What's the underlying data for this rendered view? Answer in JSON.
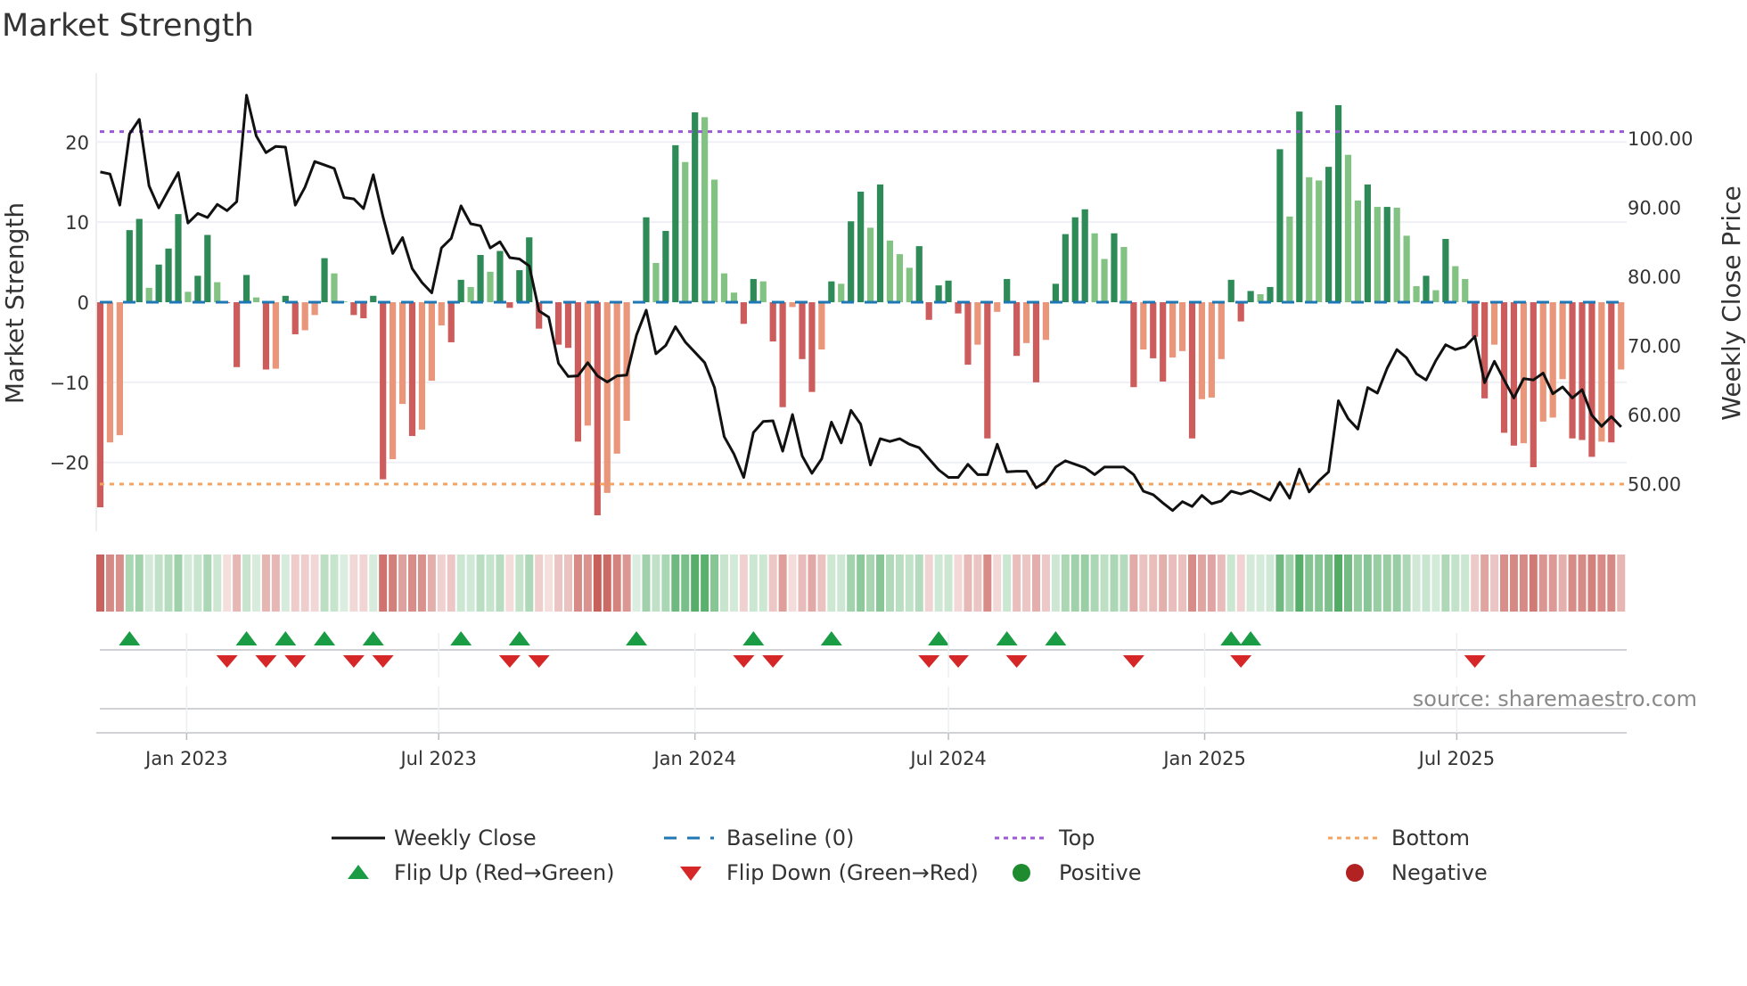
{
  "chart_data": {
    "type": "bar+line",
    "title": "Market Strength",
    "ylabel_left": "Market Strength",
    "ylabel_right": "Weekly Close Price",
    "start_date": "2022-10-31",
    "frequency": "weekly",
    "ylim_left": [
      -28.6,
      28.6
    ],
    "ylim_right": [
      43.1,
      109.4
    ],
    "left_ticks": [
      {
        "v": 20,
        "label": "20"
      },
      {
        "v": 10,
        "label": "10"
      },
      {
        "v": 0,
        "label": "0"
      },
      {
        "v": -10,
        "label": "−10"
      },
      {
        "v": -20,
        "label": "−20"
      }
    ],
    "right_ticks": [
      {
        "v": 100,
        "label": "100.00"
      },
      {
        "v": 90,
        "label": "90.00"
      },
      {
        "v": 80,
        "label": "80.00"
      },
      {
        "v": 70,
        "label": "70.00"
      },
      {
        "v": 60,
        "label": "60.00"
      },
      {
        "v": 50,
        "label": "50.00"
      }
    ],
    "x_ticks": [
      {
        "date": "2023-01-01",
        "label": "Jan 2023"
      },
      {
        "date": "2023-07-01",
        "label": "Jul 2023"
      },
      {
        "date": "2024-01-01",
        "label": "Jan 2024"
      },
      {
        "date": "2024-07-01",
        "label": "Jul 2024"
      },
      {
        "date": "2025-01-01",
        "label": "Jan 2025"
      },
      {
        "date": "2025-07-01",
        "label": "Jul 2025"
      }
    ],
    "top_level": 21.3,
    "bottom_level": -22.7,
    "baseline": 0,
    "strength": [
      -25.6,
      -17.5,
      -16.6,
      9.0,
      10.4,
      1.8,
      4.7,
      6.7,
      11.0,
      1.3,
      3.3,
      8.4,
      2.5,
      -0.1,
      -8.1,
      3.4,
      0.6,
      -8.4,
      -8.3,
      0.8,
      -4.0,
      -3.5,
      -1.6,
      5.5,
      3.6,
      0.1,
      -1.6,
      -2.0,
      0.8,
      -22.1,
      -19.6,
      -12.7,
      -16.7,
      -15.9,
      -9.8,
      -2.9,
      -5.0,
      2.8,
      1.9,
      5.9,
      3.8,
      6.4,
      -0.7,
      4.0,
      8.1,
      -3.3,
      -0.1,
      -5.3,
      -5.7,
      -17.4,
      -15.4,
      -26.6,
      -23.8,
      -18.9,
      -14.8,
      0.1,
      10.6,
      4.9,
      8.9,
      19.6,
      17.5,
      23.7,
      23.1,
      15.3,
      3.6,
      1.2,
      -2.7,
      2.9,
      2.6,
      -4.9,
      -13.1,
      -0.6,
      -7.1,
      -11.2,
      -5.9,
      2.6,
      2.3,
      10.1,
      13.8,
      9.3,
      14.7,
      7.7,
      6.0,
      4.3,
      7.0,
      -2.2,
      2.1,
      2.7,
      -1.4,
      -7.8,
      -5.3,
      -17.0,
      -1.2,
      2.9,
      -6.7,
      -5.1,
      -10.0,
      -4.7,
      2.3,
      8.5,
      10.6,
      11.6,
      8.6,
      5.4,
      8.6,
      6.9,
      -10.6,
      -5.9,
      -7.0,
      -9.9,
      -6.9,
      -6.1,
      -17.0,
      -12.1,
      -11.9,
      -7.1,
      2.8,
      -2.4,
      1.4,
      1.0,
      1.9,
      19.1,
      10.7,
      23.8,
      15.6,
      15.2,
      16.9,
      24.6,
      18.4,
      12.7,
      14.7,
      11.9,
      11.9,
      11.8,
      8.3,
      2.0,
      3.3,
      1.5,
      7.9,
      4.5,
      2.9,
      -4.3,
      -12.0,
      -5.3,
      -16.3,
      -17.9,
      -17.6,
      -20.6,
      -14.9,
      -14.4,
      -9.6,
      -17.0,
      -17.2,
      -19.3,
      -17.4,
      -17.5,
      -8.4
    ],
    "weekly_close": [
      95.1,
      94.8,
      90.3,
      100.6,
      102.7,
      93.1,
      89.9,
      92.5,
      95.0,
      87.7,
      89.1,
      88.5,
      90.4,
      89.5,
      90.8,
      106.2,
      100.3,
      97.9,
      98.8,
      98.7,
      90.3,
      92.9,
      96.6,
      96.1,
      95.6,
      91.4,
      91.2,
      89.8,
      94.7,
      88.6,
      83.3,
      85.6,
      81.1,
      79.1,
      77.6,
      84.1,
      85.5,
      90.2,
      87.6,
      87.3,
      84.1,
      85.0,
      82.7,
      82.5,
      81.5,
      75.0,
      74.1,
      67.4,
      65.5,
      65.6,
      67.5,
      65.6,
      64.7,
      65.6,
      65.7,
      71.5,
      75.1,
      68.8,
      70.0,
      72.7,
      70.5,
      69.0,
      67.5,
      63.9,
      56.8,
      54.3,
      50.9,
      57.4,
      59.0,
      59.1,
      54.7,
      60.0,
      54.0,
      51.5,
      53.6,
      58.9,
      55.9,
      60.6,
      58.6,
      52.7,
      56.5,
      56.1,
      56.5,
      55.7,
      55.2,
      53.6,
      52.0,
      50.9,
      50.9,
      52.8,
      51.3,
      51.3,
      55.7,
      51.7,
      51.8,
      51.8,
      49.4,
      50.3,
      52.4,
      53.3,
      52.8,
      52.3,
      51.3,
      52.4,
      52.4,
      52.4,
      51.3,
      48.9,
      48.4,
      47.2,
      46.1,
      47.4,
      46.7,
      48.3,
      47.1,
      47.5,
      48.9,
      48.5,
      49.0,
      48.3,
      47.6,
      50.2,
      47.9,
      52.1,
      48.8,
      50.4,
      51.7,
      62.0,
      59.4,
      57.9,
      63.9,
      63.1,
      66.7,
      69.4,
      68.2,
      65.9,
      65.0,
      67.8,
      70.1,
      69.4,
      69.8,
      71.3,
      64.6,
      67.7,
      65.0,
      62.4,
      65.2,
      65.0,
      66.0,
      63.0,
      64.0,
      62.4,
      63.6,
      59.9,
      58.3,
      59.7,
      58.2
    ],
    "legend_position": "bottom-center",
    "legend": [
      {
        "key": "close",
        "label": "Weekly Close"
      },
      {
        "key": "baseline",
        "label": "Baseline (0)"
      },
      {
        "key": "top",
        "label": "Top"
      },
      {
        "key": "bottom",
        "label": "Bottom"
      },
      {
        "key": "flip_up",
        "label": "Flip Up (Red→Green)"
      },
      {
        "key": "flip_down",
        "label": "Flip Down (Green→Red)"
      },
      {
        "key": "positive",
        "label": "Positive"
      },
      {
        "key": "negative",
        "label": "Negative"
      }
    ],
    "source": "source: sharemaestro.com"
  },
  "colors": {
    "pos_strong": "#2e8b57",
    "pos_weak": "#82c282",
    "neg_strong": "#cd5c5c",
    "neg_weak": "#e9967a",
    "close": "#111111",
    "baseline": "#1f77b4",
    "top": "#9b59d6",
    "bottom": "#f4a460",
    "flip_up": "#1a9c45",
    "flip_down": "#d62728",
    "positive": "#1e8c2e",
    "negative": "#b22222"
  }
}
